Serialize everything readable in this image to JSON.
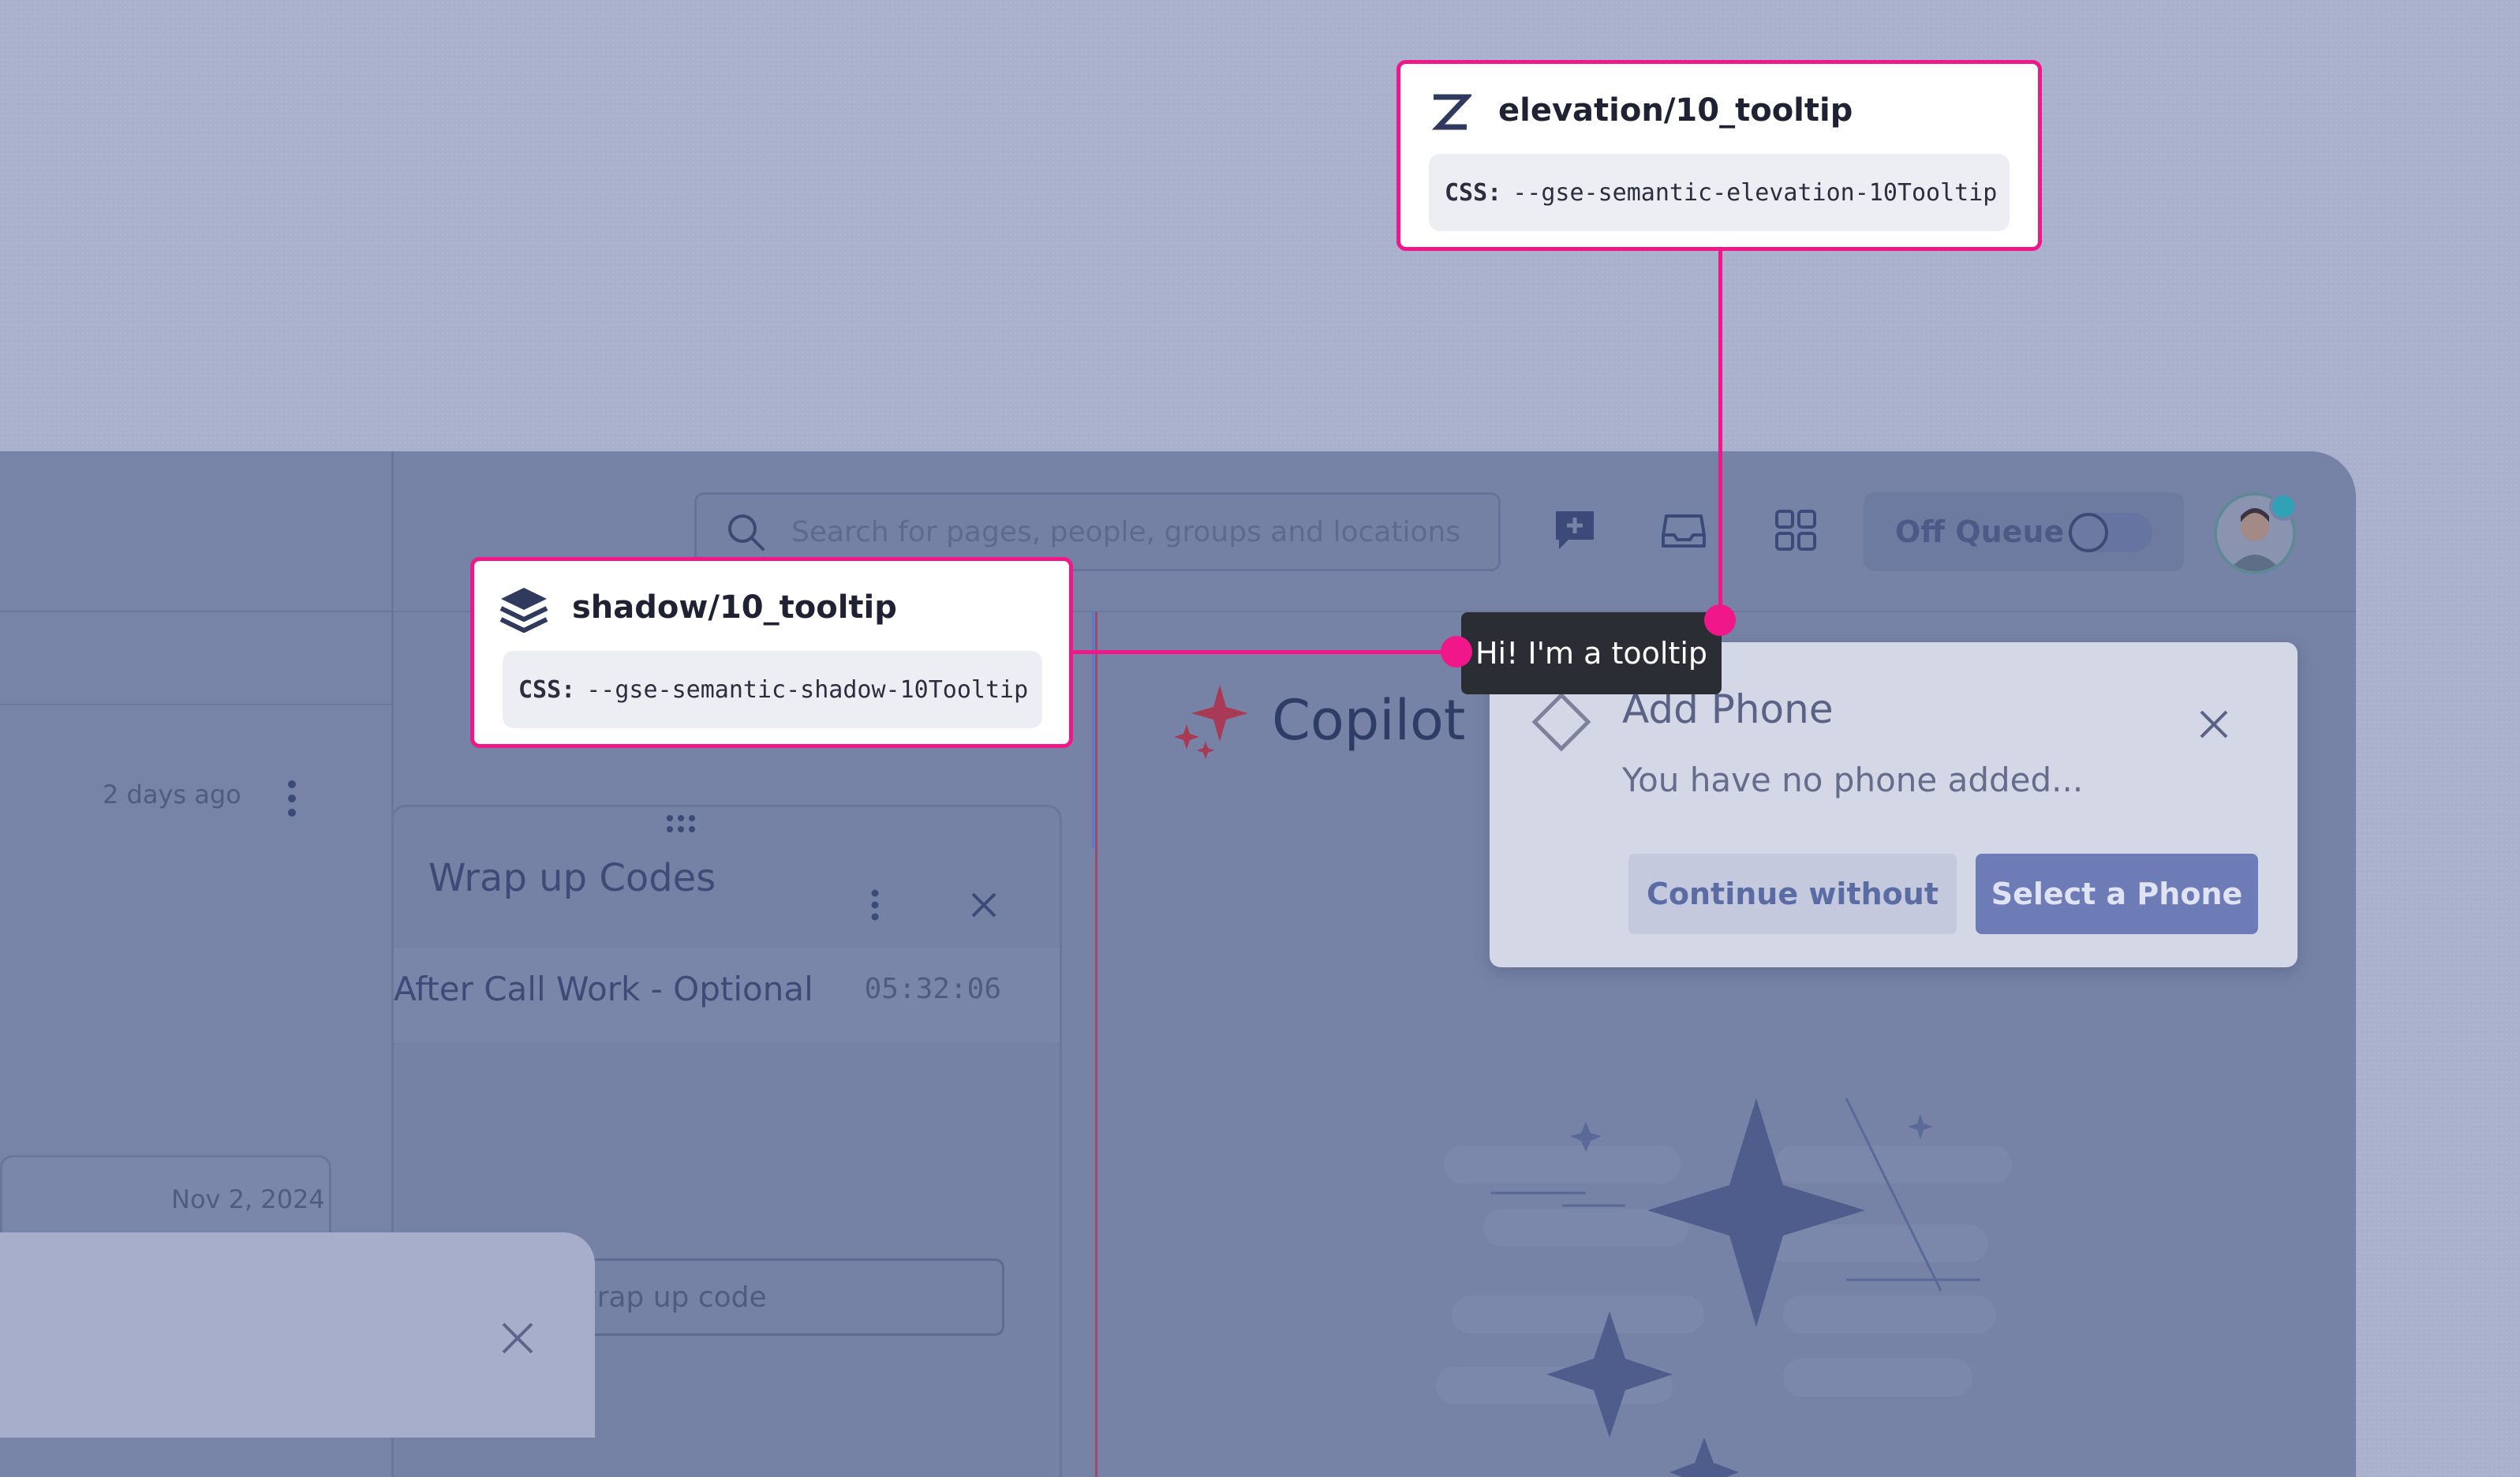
{
  "app": {
    "search_placeholder": "Search for pages, people, groups and locations",
    "off_queue_label": "Off Queue",
    "left_list": {
      "item_time": "2 days ago",
      "card_date": "Nov 2, 2024"
    },
    "wrap_up": {
      "title": "Wrap up  Codes",
      "row_label": "After Call Work - Optional",
      "row_timer": "05:32:06",
      "search_placeholder": "Search wrap up code"
    },
    "copilot": {
      "title": "Copilot"
    },
    "add_phone_dialog": {
      "title": "Add Phone",
      "message": "You have no phone added...",
      "continue_label": "Continue without",
      "select_label": "Select a Phone"
    }
  },
  "tooltip": {
    "text": "Hi! I'm a tooltip"
  },
  "annotations": {
    "elevation": {
      "title": "elevation/10_tooltip",
      "css_label": "CSS:",
      "css_value": "--gse-semantic-elevation-10Tooltip",
      "icon": "z-elevation-icon"
    },
    "shadow": {
      "title": "shadow/10_tooltip",
      "css_label": "CSS:",
      "css_value": "--gse-semantic-shadow-10Tooltip",
      "icon": "layers-icon"
    },
    "accent_color": "#f0178a"
  }
}
